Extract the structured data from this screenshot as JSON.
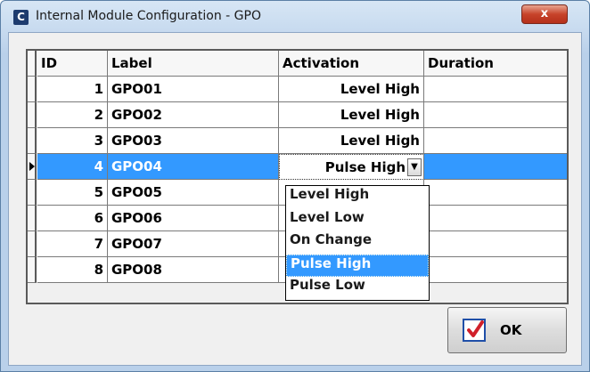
{
  "window": {
    "app_icon_letter": "C",
    "title": "Internal Module Configuration - GPO",
    "close_label": "x"
  },
  "grid": {
    "columns": [
      "ID",
      "Label",
      "Activation",
      "Duration"
    ],
    "rows": [
      {
        "id": "1",
        "label": "GPO01",
        "activation": "Level High",
        "duration": ""
      },
      {
        "id": "2",
        "label": "GPO02",
        "activation": "Level High",
        "duration": ""
      },
      {
        "id": "3",
        "label": "GPO03",
        "activation": "Level High",
        "duration": ""
      },
      {
        "id": "4",
        "label": "GPO04",
        "activation": "Pulse High",
        "duration": ""
      },
      {
        "id": "5",
        "label": "GPO05",
        "activation": "",
        "duration": ""
      },
      {
        "id": "6",
        "label": "GPO06",
        "activation": "",
        "duration": ""
      },
      {
        "id": "7",
        "label": "GPO07",
        "activation": "",
        "duration": ""
      },
      {
        "id": "8",
        "label": "GPO08",
        "activation": "",
        "duration": ""
      }
    ],
    "selected_row_index": 3
  },
  "activation_dropdown": {
    "options": [
      "Level High",
      "Level Low",
      "On Change",
      "Pulse High",
      "Pulse Low"
    ],
    "highlighted": "Pulse High",
    "arrow_icon": "chevron-down-icon"
  },
  "buttons": {
    "ok_label": "OK",
    "ok_icon": "check-icon"
  },
  "colors": {
    "selection": "#3399ff",
    "title_bar": "#c4d8ee",
    "close_button": "#c7432a"
  }
}
